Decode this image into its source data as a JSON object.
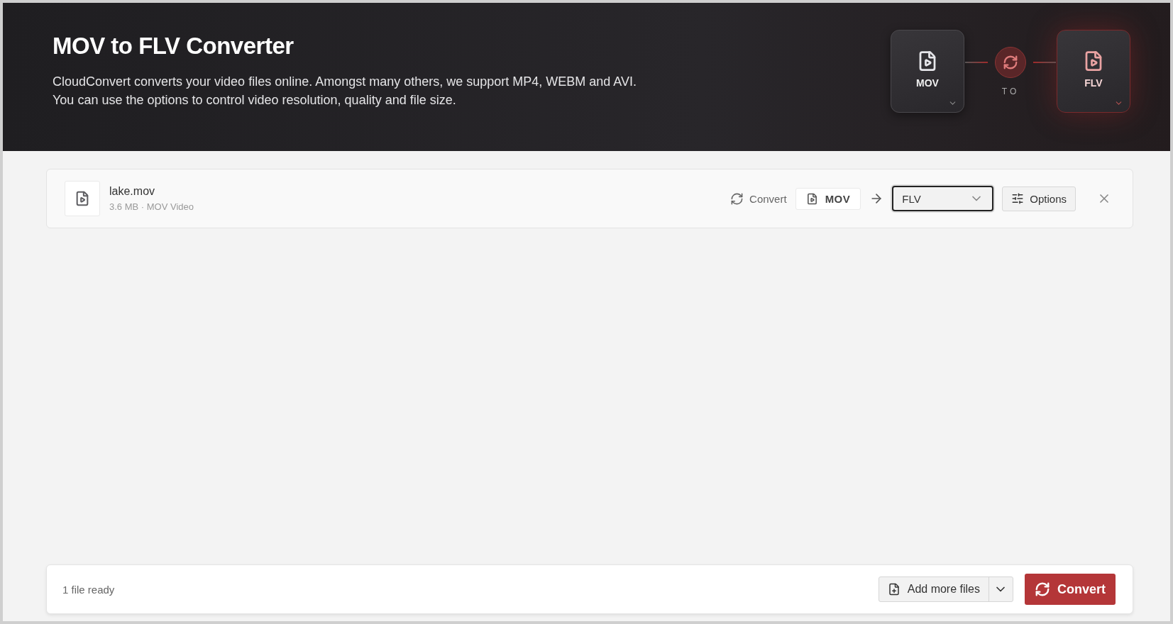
{
  "header": {
    "title": "MOV to FLV Converter",
    "description": [
      "CloudConvert converts your video files online. Amongst many others, we support MP4, WEBM and AVI.",
      "You can use the options to control video resolution, quality and file size."
    ],
    "formats": [
      {
        "label": "MOV",
        "active": false
      },
      {
        "label": "FLV",
        "active": true
      }
    ],
    "connector_label": "TO"
  },
  "file": {
    "name": "lake.mov",
    "meta": "3.6 MB · MOV Video",
    "action": "Convert",
    "source_format": "MOV",
    "target_format": "FLV",
    "options_label": "Options"
  },
  "footer": {
    "status": "1 file ready",
    "add_files_label": "Add more files",
    "convert_label": "Convert"
  }
}
